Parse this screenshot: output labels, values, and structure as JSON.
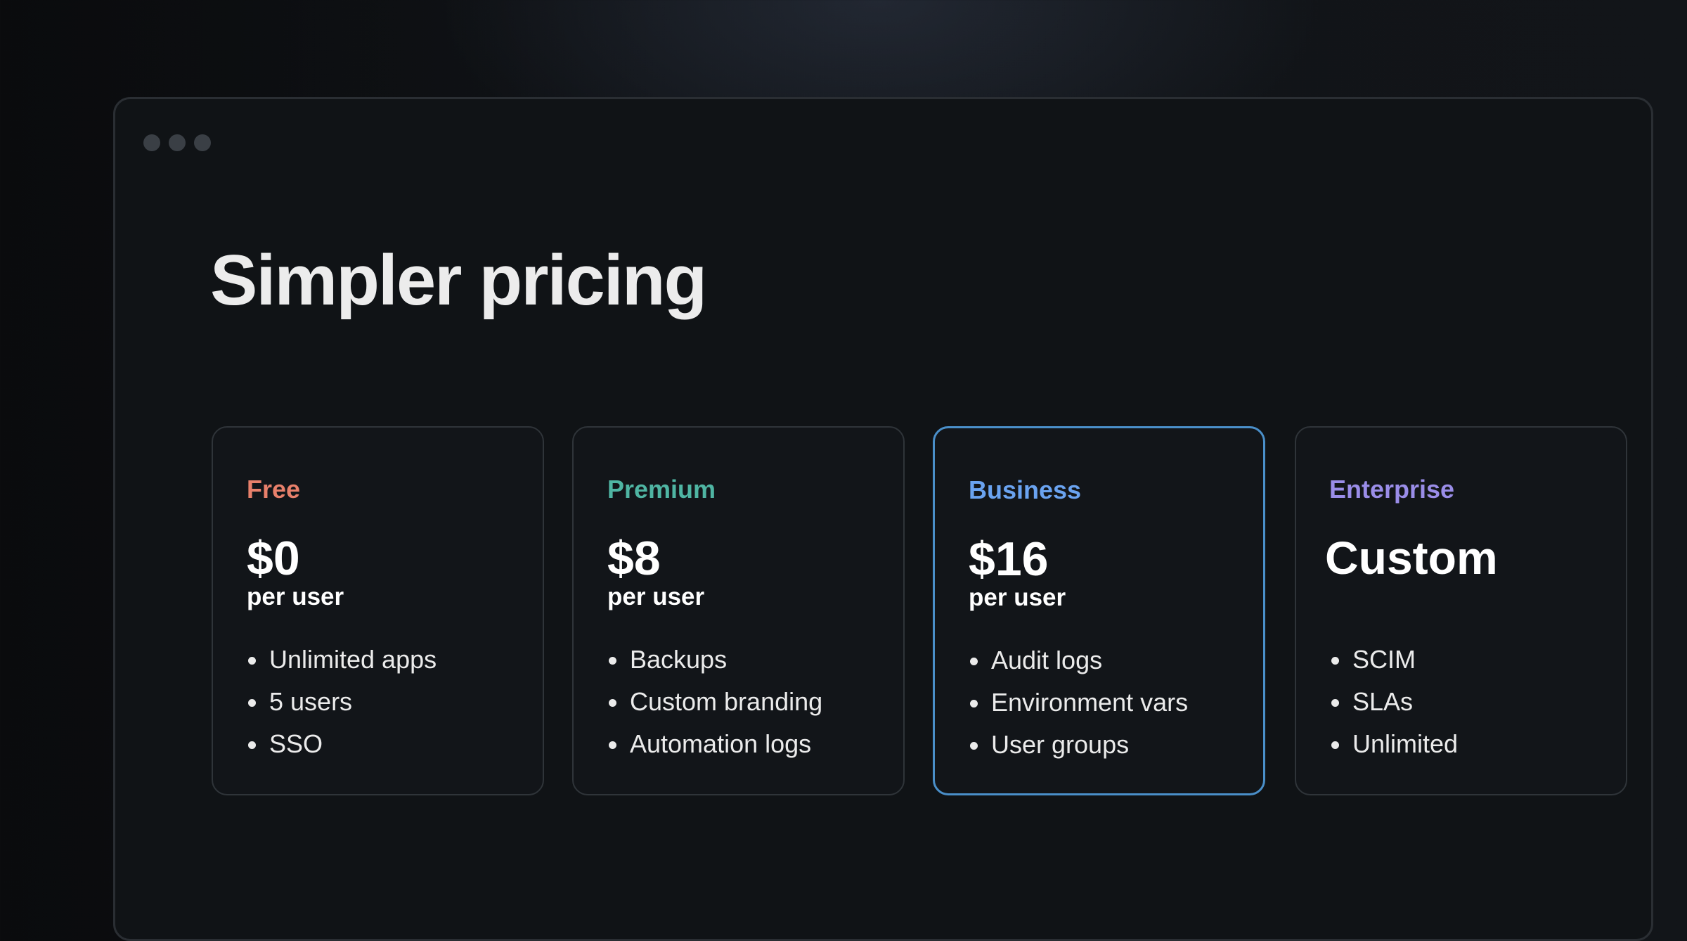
{
  "page": {
    "title": "Simpler pricing"
  },
  "colors": {
    "free": "#e8806b",
    "premium": "#4fb5a3",
    "business": "#6aa3f0",
    "enterprise": "#9a8de8",
    "selected_border": "#4a8fc9"
  },
  "plans": [
    {
      "name": "Free",
      "price": "$0",
      "unit": "per user",
      "features": [
        "Unlimited apps",
        "5 users",
        "SSO"
      ]
    },
    {
      "name": "Premium",
      "price": "$8",
      "unit": "per user",
      "features": [
        "Backups",
        "Custom branding",
        "Automation logs"
      ]
    },
    {
      "name": "Business",
      "price": "$16",
      "unit": "per user",
      "selected": true,
      "features": [
        "Audit logs",
        "Environment vars",
        "User groups"
      ]
    },
    {
      "name": "Enterprise",
      "price": "Custom",
      "unit": "",
      "features": [
        "SCIM",
        "SLAs",
        "Unlimited"
      ]
    }
  ]
}
